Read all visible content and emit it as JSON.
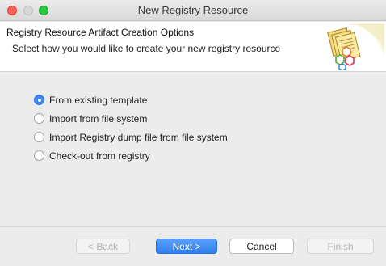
{
  "window": {
    "title": "New Registry Resource"
  },
  "header": {
    "title": "Registry Resource Artifact Creation Options",
    "description": "Select how you would like to create your new registry resource",
    "icon": "registry-resource-banner-icon"
  },
  "options": [
    {
      "label": "From existing template",
      "selected": true
    },
    {
      "label": "Import from file system",
      "selected": false
    },
    {
      "label": "Import Registry dump file from file system",
      "selected": false
    },
    {
      "label": "Check-out from registry",
      "selected": false
    }
  ],
  "buttons": {
    "back": {
      "label": "< Back",
      "enabled": false
    },
    "next": {
      "label": "Next >",
      "enabled": true
    },
    "cancel": {
      "label": "Cancel",
      "enabled": true
    },
    "finish": {
      "label": "Finish",
      "enabled": false
    }
  },
  "colors": {
    "accent": "#3c87f6",
    "close": "#fe5f57",
    "maximize": "#28c840"
  }
}
